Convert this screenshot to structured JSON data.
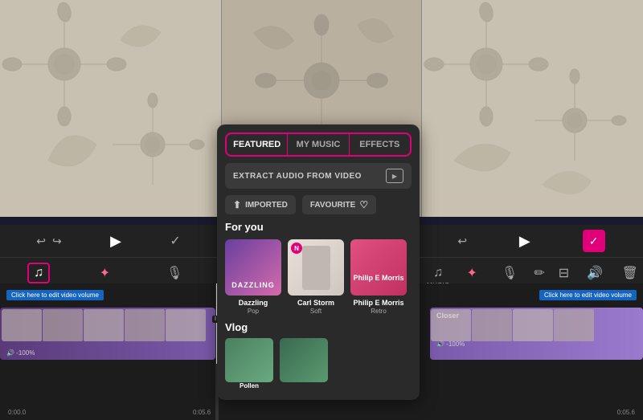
{
  "tabs": {
    "items": [
      {
        "label": "FEATURED",
        "active": true
      },
      {
        "label": "MY MUSIC",
        "active": false
      },
      {
        "label": "EFFECTS",
        "active": false
      }
    ]
  },
  "extract_audio": {
    "label": "EXTRACT AUDIO FROM VIDEO"
  },
  "filters": {
    "imported": "IMPORTED",
    "favourite": "FAVOURITE"
  },
  "for_you": {
    "title": "For you",
    "cards": [
      {
        "name": "Dazzling",
        "genre": "Pop",
        "type": "dazzling",
        "new": false
      },
      {
        "name": "Carl Storm",
        "genre": "Soft",
        "type": "carlstorm",
        "new": true
      },
      {
        "name": "Philip E Morris",
        "genre": "Retro",
        "type": "philip",
        "new": false
      }
    ]
  },
  "vlog": {
    "title": "Vlog",
    "cards": [
      {
        "name": "Pollen",
        "genre": ""
      }
    ]
  },
  "toolbar_left": {
    "items": [
      {
        "icon": "♩",
        "label": "MUSIC",
        "active": true
      },
      {
        "icon": "✦",
        "label": "EFFECTS",
        "active": false
      },
      {
        "icon": "🎤",
        "label": "RECORD",
        "active": false
      }
    ]
  },
  "toolbar_right": {
    "items": [
      {
        "icon": "♩",
        "label": "MUSIC",
        "active": false
      },
      {
        "icon": "✦",
        "label": "EFFECTS",
        "active": false
      },
      {
        "icon": "🎤",
        "label": "RECORD",
        "active": false
      },
      {
        "icon": "✏",
        "label": "EDIT",
        "active": false
      },
      {
        "icon": "△",
        "label": "SPLIT",
        "active": false
      },
      {
        "icon": "🔊",
        "label": "VOLUME",
        "active": false
      },
      {
        "icon": "🗑",
        "label": "DELETE",
        "active": false
      }
    ]
  },
  "timeline": {
    "left_track_label": "Click here to edit video volume",
    "left_track_volume": "🔊 -100%",
    "right_track_name": "Closer",
    "right_track_label": "Click here to edit video volume",
    "right_track_volume": "🔊 -100%",
    "time_left": "0:00.0",
    "time_right_mid": "0:05.6",
    "time_right_end": "0:05.6"
  },
  "checkmark": "✓",
  "nav": {
    "undo": "↩",
    "redo": "↪",
    "play": "▶"
  }
}
